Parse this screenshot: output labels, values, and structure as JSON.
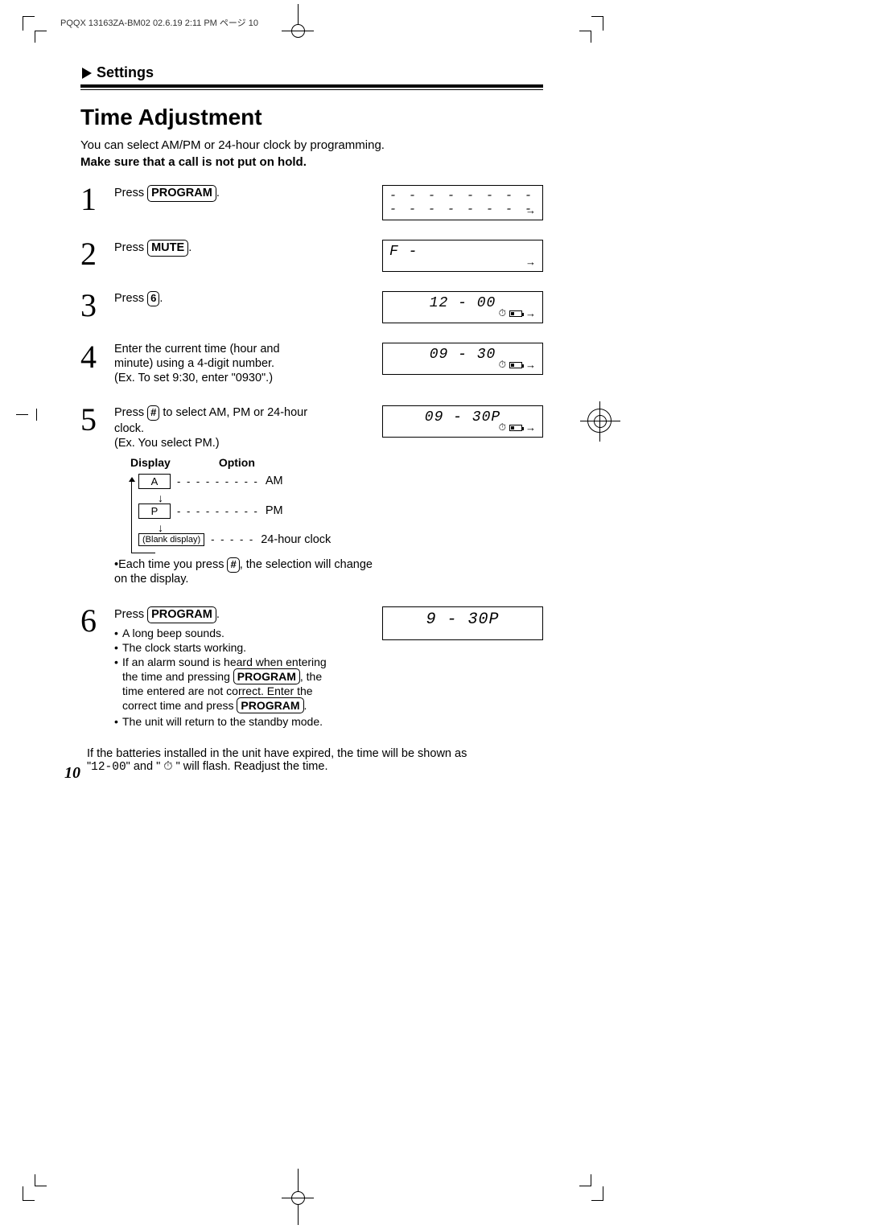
{
  "header_print_info": "PQQX 13163ZA-BM02  02.6.19 2:11 PM  ページ 10",
  "section_label": "Settings",
  "page_title": "Time Adjustment",
  "intro": "You can select AM/PM or 24-hour clock by programming.",
  "intro_bold": "Make sure that a call is not put on hold.",
  "steps": {
    "s1": {
      "num": "1",
      "text_prefix": "Press ",
      "key": "PROGRAM",
      "text_suffix": "."
    },
    "s2": {
      "num": "2",
      "text_prefix": "Press ",
      "key": "MUTE",
      "text_suffix": "."
    },
    "s3": {
      "num": "3",
      "text_prefix": "Press ",
      "key": "6",
      "text_suffix": "."
    },
    "s4": {
      "num": "4",
      "l1": "Enter the current time (hour and",
      "l2": "minute) using a 4-digit number.",
      "l3": "(Ex. To set 9:30, enter \"0930\".)"
    },
    "s5": {
      "num": "5",
      "l1_prefix": "Press ",
      "l1_key": "#",
      "l1_suffix": " to select AM, PM or 24-hour",
      "l2": "clock.",
      "l3": "(Ex. You select PM.)"
    },
    "s6": {
      "num": "6",
      "l1_prefix": "Press ",
      "l1_key": "PROGRAM",
      "l1_suffix": "."
    }
  },
  "lcd": {
    "d1": "- - - - - - - - - - - - - - - -",
    "d2": "F -",
    "d3": "12 - 00",
    "d4": "09 - 30",
    "d5": "09 - 30P",
    "d6": "9 - 30P"
  },
  "display_table": {
    "header_display": "Display",
    "header_option": "Option",
    "rows": [
      {
        "display": "A",
        "option": "AM"
      },
      {
        "display": "P",
        "option": "PM"
      },
      {
        "display": "(Blank display)",
        "option": "24-hour clock"
      }
    ]
  },
  "step5_note_prefix": "Each time you press ",
  "step5_note_key": "#",
  "step5_note_suffix": ", the selection will change on the display.",
  "step6_bullets": {
    "b1": "A long beep sounds.",
    "b2": "The clock starts working.",
    "b3a": "If an alarm sound is heard when entering",
    "b3b_prefix": "the time and pressing ",
    "b3b_key": "PROGRAM",
    "b3b_suffix": ", the",
    "b3c": "time entered are not correct. Enter the",
    "b3d_prefix": "correct time and press ",
    "b3d_key": "PROGRAM",
    "b3d_suffix": ".",
    "b4": "The unit will return to the standby mode."
  },
  "footer_note_l1": "If the batteries installed in the unit have expired, the time will be shown as",
  "footer_note_l2_prefix": "\"",
  "footer_note_l2_code": "12-00",
  "footer_note_l2_mid": "\" and \" ",
  "footer_note_l2_suffix": " \" will flash. Readjust the time.",
  "page_number": "10"
}
